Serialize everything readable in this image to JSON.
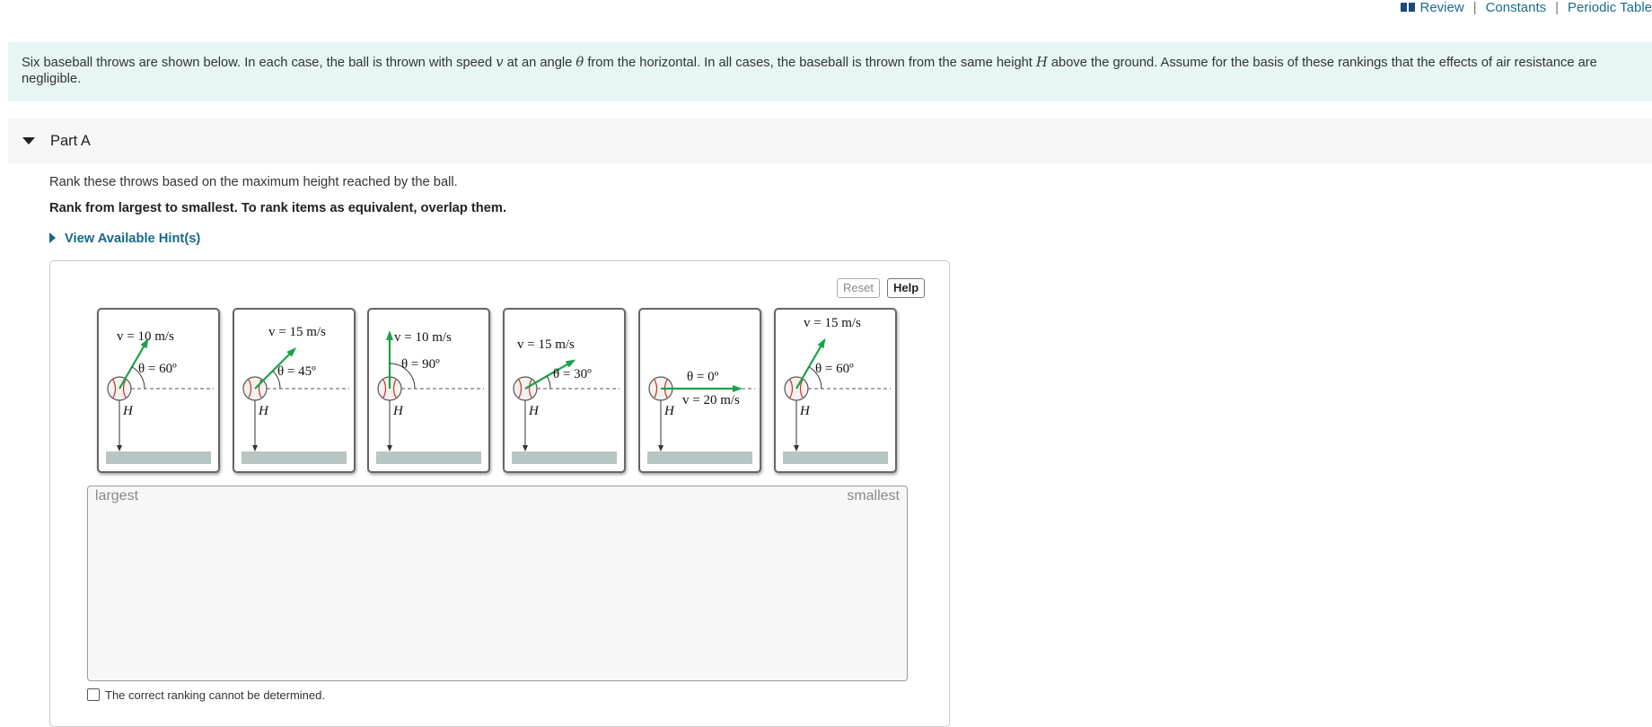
{
  "topnav": {
    "review": "Review",
    "constants": "Constants",
    "periodic": "Periodic Table"
  },
  "intro": {
    "t1": "Six baseball throws are shown below. In each case, the ball is thrown with speed ",
    "v": "v",
    "t2": " at an angle ",
    "theta": "θ",
    "t3": " from the horizontal. In all cases, the baseball is thrown from the same height ",
    "H": "H",
    "t4": " above the ground. Assume for the basis of these rankings that the effects of air resistance are negligible."
  },
  "part": {
    "title": "Part A"
  },
  "question": {
    "text": "Rank these throws based on the maximum height reached by the ball.",
    "instruction": "Rank from largest to smallest. To rank items as equivalent, overlap them.",
    "hint": "View Available Hint(s)"
  },
  "buttons": {
    "reset": "Reset",
    "help": "Help"
  },
  "cards": [
    {
      "v_label": "v = 10 m/s",
      "theta_label": "θ = 60º",
      "angle_deg": 60,
      "h_label": "H"
    },
    {
      "v_label": "v = 15 m/s",
      "theta_label": "θ = 45º",
      "angle_deg": 45,
      "h_label": "H"
    },
    {
      "v_label": "v = 10 m/s",
      "theta_label": "θ = 90º",
      "angle_deg": 90,
      "h_label": "H"
    },
    {
      "v_label": "v = 15 m/s",
      "theta_label": "θ = 30º",
      "angle_deg": 30,
      "h_label": "H"
    },
    {
      "v_label": "v = 20 m/s",
      "theta_label": "θ = 0º",
      "angle_deg": 0,
      "h_label": "H"
    },
    {
      "v_label": "v = 15 m/s",
      "theta_label": "θ = 60º",
      "angle_deg": 60,
      "h_label": "H"
    }
  ],
  "ranking": {
    "largest": "largest",
    "smallest": "smallest"
  },
  "checkbox": {
    "label": "The correct ranking cannot be determined."
  },
  "colors": {
    "accent": "#16698c",
    "arrow": "#19a34a",
    "intro_bg": "#e8f5f5"
  }
}
